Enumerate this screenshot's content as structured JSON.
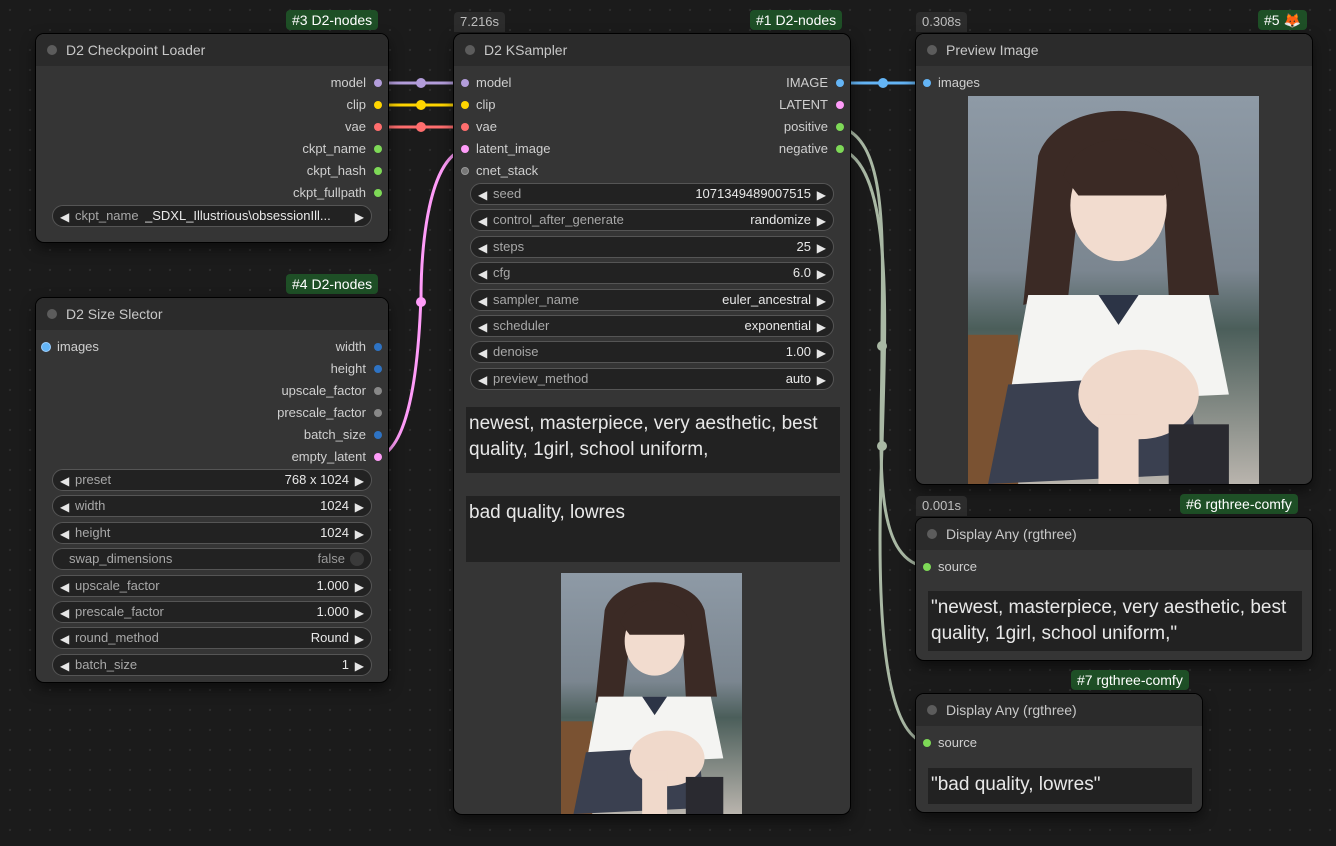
{
  "colors": {
    "model": "#b39ddb",
    "clip": "#ffd500",
    "vae": "#ff6e6e",
    "latent": "#ff9cf9",
    "image": "#64b5f6",
    "conditioning": "#ffa931",
    "string": "#7ed957",
    "int": "#2e73c4",
    "float": "#aaaaaa",
    "badge_bg": "#1e4f26",
    "wire_cond": "#a9b8a4"
  },
  "checkpoint_loader": {
    "badge": "#3 D2-nodes",
    "title": "D2 Checkpoint Loader",
    "outputs": [
      "model",
      "clip",
      "vae",
      "ckpt_name",
      "ckpt_hash",
      "ckpt_fullpath"
    ],
    "widget": {
      "label": "ckpt_name",
      "value": "_SDXL_Illustrious\\obsessionIll..."
    }
  },
  "size_selector": {
    "badge": "#4 D2-nodes",
    "title": "D2 Size Slector",
    "input": "images",
    "outputs": [
      "width",
      "height",
      "upscale_factor",
      "prescale_factor",
      "batch_size",
      "empty_latent"
    ],
    "widgets": [
      {
        "label": "preset",
        "value": "768 x 1024"
      },
      {
        "label": "width",
        "value": "1024"
      },
      {
        "label": "height",
        "value": "1024"
      },
      {
        "label": "swap_dimensions",
        "value": "false"
      },
      {
        "label": "upscale_factor",
        "value": "1.000"
      },
      {
        "label": "prescale_factor",
        "value": "1.000"
      },
      {
        "label": "round_method",
        "value": "Round"
      },
      {
        "label": "batch_size",
        "value": "1"
      }
    ]
  },
  "ksampler": {
    "timer": "7.216s",
    "badge": "#1 D2-nodes",
    "title": "D2 KSampler",
    "inputs": [
      "model",
      "clip",
      "vae",
      "latent_image",
      "cnet_stack"
    ],
    "outputs": [
      "IMAGE",
      "LATENT",
      "positive",
      "negative"
    ],
    "widgets": [
      {
        "label": "seed",
        "value": "1071349489007515"
      },
      {
        "label": "control_after_generate",
        "value": "randomize"
      },
      {
        "label": "steps",
        "value": "25"
      },
      {
        "label": "cfg",
        "value": "6.0"
      },
      {
        "label": "sampler_name",
        "value": "euler_ancestral"
      },
      {
        "label": "scheduler",
        "value": "exponential"
      },
      {
        "label": "denoise",
        "value": "1.00"
      },
      {
        "label": "preview_method",
        "value": "auto"
      }
    ],
    "positive_prompt": "newest, masterpiece, very aesthetic, best quality, 1girl, school uniform,",
    "negative_prompt": "bad quality, lowres"
  },
  "preview_image": {
    "timer": "0.308s",
    "badge": "#5 🦊",
    "title": "Preview Image",
    "input": "images"
  },
  "display_any_1": {
    "timer": "0.001s",
    "badge": "#6 rgthree-comfy",
    "title": "Display Any (rgthree)",
    "input": "source",
    "text": "\"newest, masterpiece, very aesthetic, best quality, 1girl, school uniform,\""
  },
  "display_any_2": {
    "badge": "#7 rgthree-comfy",
    "title": "Display Any (rgthree)",
    "input": "source",
    "text": "\"bad quality, lowres\""
  }
}
